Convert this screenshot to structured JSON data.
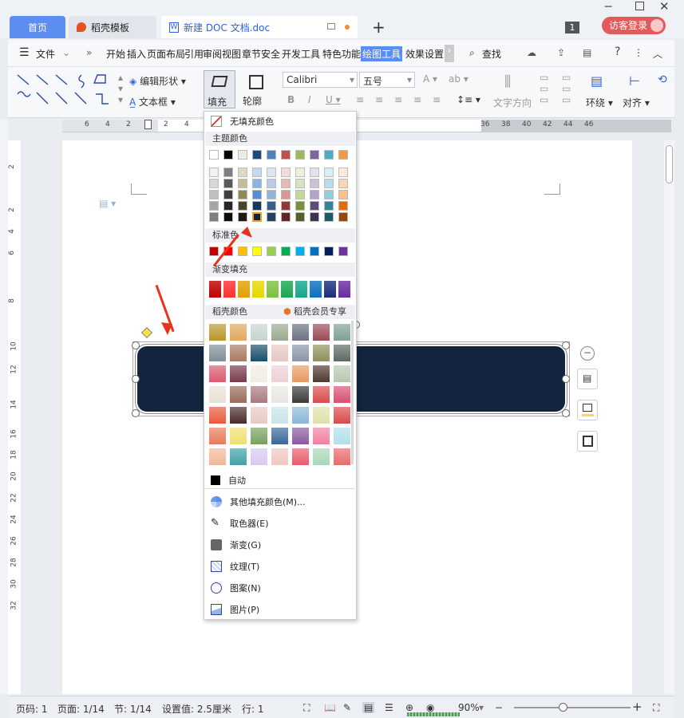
{
  "tabs": {
    "home": "首页",
    "template": "稻壳模板",
    "doc": "新建 DOC 文档.doc",
    "login": "访客登录",
    "badge": "1"
  },
  "menu": {
    "file": "文件",
    "items": [
      "开始",
      "插入",
      "页面布局",
      "引用",
      "审阅",
      "视图",
      "章节",
      "安全",
      "开发工具",
      "特色功能",
      "绘图工具",
      "效果设置"
    ],
    "search": "查找"
  },
  "ribbon": {
    "edit_shape": "编辑形状",
    "text_box": "文本框",
    "fill": "填充",
    "outline": "轮廓",
    "font": "Calibri",
    "size": "五号",
    "text_dir": "文字方向",
    "wrap": "环绕",
    "align": "对齐"
  },
  "ruler_top": [
    "6",
    "4",
    "2",
    "2",
    "4",
    "36",
    "38",
    "40",
    "42",
    "44",
    "46"
  ],
  "ruler_left": [
    "2",
    "2",
    "4",
    "6",
    "8",
    "10",
    "12",
    "14",
    "16",
    "18",
    "20",
    "22",
    "24",
    "26",
    "28",
    "30",
    "32"
  ],
  "dropdown": {
    "no_fill": "无填充颜色",
    "theme_title": "主题颜色",
    "theme_top": [
      "#ffffff",
      "#000000",
      "#eeece1",
      "#1f497d",
      "#4f81bd",
      "#c0504d",
      "#9bbb59",
      "#8064a2",
      "#4bacc6",
      "#f79646"
    ],
    "theme_rows": [
      [
        "#f2f2f2",
        "#7f7f7f",
        "#ddd9c3",
        "#c6d9f0",
        "#dbe5f1",
        "#f2dcdb",
        "#ebf1dd",
        "#e5e0ec",
        "#dbeef3",
        "#fdeada"
      ],
      [
        "#d8d8d8",
        "#595959",
        "#c4bd97",
        "#8db3e2",
        "#b8cce4",
        "#e5b9b7",
        "#d7e3bc",
        "#ccc1d9",
        "#b7dde8",
        "#fbd5b5"
      ],
      [
        "#bfbfbf",
        "#3f3f3f",
        "#938953",
        "#548dd4",
        "#95b3d7",
        "#d99694",
        "#c3d69b",
        "#b2a2c7",
        "#92cddc",
        "#fac08f"
      ],
      [
        "#a5a5a5",
        "#262626",
        "#494429",
        "#17365d",
        "#366092",
        "#953734",
        "#76923c",
        "#5f497a",
        "#31859b",
        "#e36c09"
      ],
      [
        "#7f7f7f",
        "#0c0c0c",
        "#1d1b10",
        "#0f243e",
        "#244061",
        "#632423",
        "#4f6128",
        "#3f3151",
        "#205867",
        "#974806"
      ]
    ],
    "std_title": "标准色",
    "std": [
      "#c00000",
      "#ff0000",
      "#ffc000",
      "#ffff00",
      "#92d050",
      "#00b050",
      "#00b0f0",
      "#0070c0",
      "#002060",
      "#7030a0"
    ],
    "grad_title": "渐变填充",
    "grad": [
      "#c00000",
      "#ff3030",
      "#e0a000",
      "#e6d800",
      "#7bc142",
      "#1aa650",
      "#14a88a",
      "#0a70c0",
      "#1a2d7a",
      "#6a2aa0"
    ],
    "dk_title": "稻壳颜色",
    "dk_member": "稻壳会员专享",
    "dk": [
      [
        "#b8962e",
        "#e0a85a",
        "#c8d4d0",
        "#9aa890",
        "#6a7180",
        "#9a4a55",
        "#7fa090"
      ],
      [
        "#7f8f94",
        "#a97a62",
        "#1a4d6a",
        "#e8c6c4",
        "#8a95a8",
        "#8f8f5a",
        "#5a6a62"
      ],
      [
        "#d95a6e",
        "#7a3a4a",
        "#f2ede2",
        "#ecd0d8",
        "#e89a60",
        "#4d3a30",
        "#b8c8b0"
      ],
      [
        "#e8e0d4",
        "#9a6a58",
        "#a87a80",
        "#e8e6e0",
        "#3a3a3a",
        "#d84a4a",
        "#d85070"
      ],
      [
        "#e85a3a",
        "#4a2a2a",
        "#e8c8c4",
        "#c8e4e8",
        "#8ab8d8",
        "#e0e0a8",
        "#d84a4a"
      ],
      [
        "#e87a5a",
        "#f0e070",
        "#78a060",
        "#3a6898",
        "#8a5aa0",
        "#f080a0",
        "#b0e0e8"
      ],
      [
        "#f0b898",
        "#40a0a8",
        "#d8c8f0",
        "#f0c8c0",
        "#e85a6a",
        "#a8d8b8",
        "#e86a6a"
      ]
    ],
    "auto": "自动",
    "items": [
      "其他填充颜色(M)...",
      "取色器(E)",
      "渐变(G)",
      "纹理(T)",
      "图案(N)",
      "图片(P)"
    ]
  },
  "status": {
    "pagenum": "页码: 1",
    "pages": "页面: 1/14",
    "section": "节: 1/14",
    "setting": "设置值: 2.5厘米",
    "row": "行: 1",
    "zoom": "90%"
  },
  "colors": {
    "shape_fill": "#13243e",
    "accent": "#5a8ef7",
    "arrow": "#e8321c"
  }
}
